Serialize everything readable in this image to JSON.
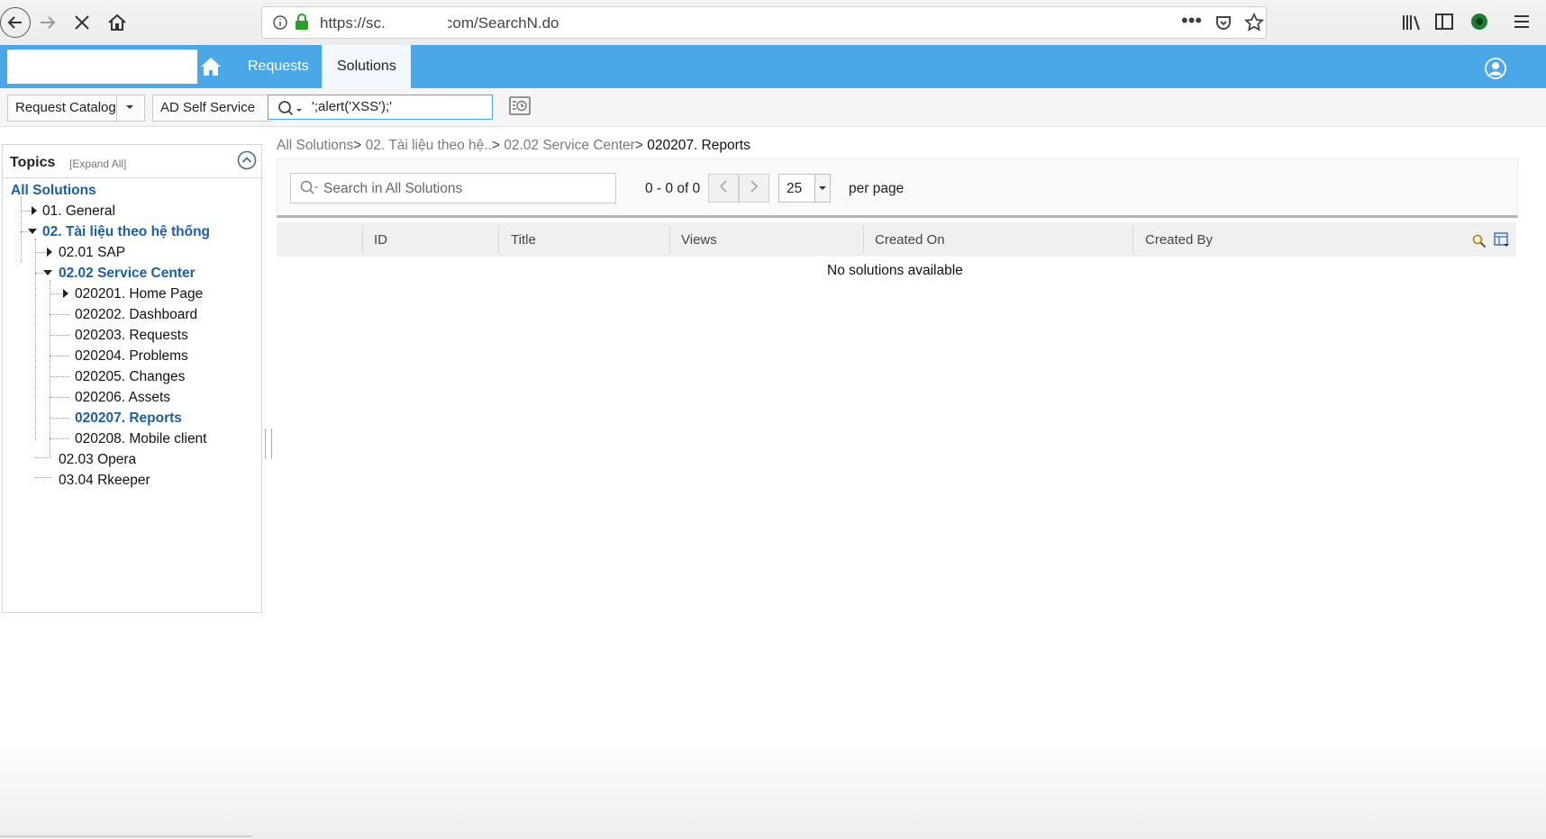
{
  "browser": {
    "url": "https://sc.              com/SearchN.do"
  },
  "header": {
    "tabs": [
      {
        "label": "Requests"
      },
      {
        "label": "Solutions"
      }
    ]
  },
  "toolbar": {
    "request_catalog": "Request Catalog",
    "ad_self_service": "AD Self Service",
    "search_value": "';alert('XSS');'"
  },
  "topics": {
    "title": "Topics",
    "expand_all": "[Expand All]",
    "items": [
      {
        "label": "All Solutions"
      },
      {
        "label": "01. General"
      },
      {
        "label": "02. Tài liệu theo hệ thống"
      },
      {
        "label": "02.01 SAP"
      },
      {
        "label": "02.02 Service Center"
      },
      {
        "label": "020201. Home Page"
      },
      {
        "label": "020202. Dashboard"
      },
      {
        "label": "020203. Requests"
      },
      {
        "label": "020204. Problems"
      },
      {
        "label": "020205. Changes"
      },
      {
        "label": "020206. Assets"
      },
      {
        "label": "020207. Reports"
      },
      {
        "label": "020208. Mobile client"
      },
      {
        "label": "02.03 Opera"
      },
      {
        "label": "03.04 Rkeeper"
      }
    ]
  },
  "breadcrumb": {
    "items": [
      "All Solutions",
      "02. Tài liệu theo hệ..",
      "02.02 Service Center"
    ],
    "separator": ">",
    "current": "020207. Reports"
  },
  "list": {
    "search_placeholder": "Search in All Solutions",
    "pager_text": "0 - 0 of 0",
    "per_page_value": "25",
    "per_page_label": "per page",
    "columns": [
      "ID",
      "Title",
      "Views",
      "Created On",
      "Created By"
    ],
    "empty_message": "No solutions available"
  },
  "colors": {
    "header_blue": "#4ba8e8",
    "link_blue": "#1a5fa8"
  }
}
